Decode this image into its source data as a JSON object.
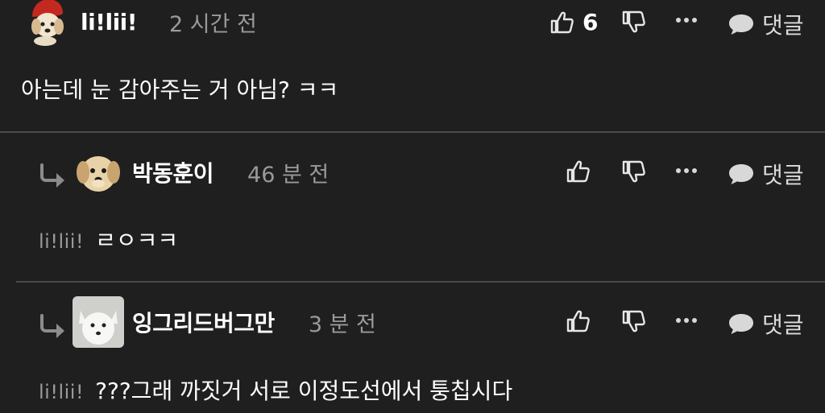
{
  "comments": [
    {
      "username": "li!lii!",
      "time": "2 시간 전",
      "text": "아는데 눈 감아주는 거 아님? ㅋㅋ",
      "likes": "6",
      "reply_label": "댓글"
    },
    {
      "username": "박동훈이",
      "time": "46 분 전",
      "mention": "li!lii!",
      "text": "ㄹㅇㅋㅋ",
      "reply_label": "댓글"
    },
    {
      "username": "잉그리드버그만",
      "time": "3 분 전",
      "mention": "li!lii!",
      "text": "???그래 까짓거 서로 이정도선에서 퉁칩시다",
      "reply_label": "댓글"
    }
  ],
  "icons": {
    "like": "thumbs-up-icon",
    "dislike": "thumbs-down-icon",
    "more": "more-dots-icon",
    "reply": "speech-bubble-icon",
    "reply_arrow": "reply-arrow-icon"
  },
  "colors": {
    "background": "#1f1f1f",
    "text": "#ffffff",
    "muted": "#9a9a9a",
    "divider": "#4a4a4a"
  }
}
